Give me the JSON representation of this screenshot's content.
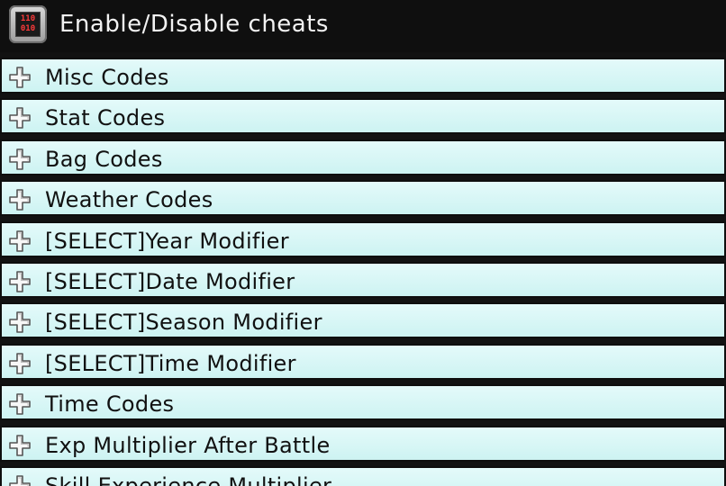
{
  "header": {
    "title": "Enable/Disable cheats",
    "app_icon": {
      "name": "cheat-chip-icon",
      "glyph_text": "110\n010",
      "glyph_color": "#ff3b3b"
    }
  },
  "colors": {
    "row_background": "#d4f5f4",
    "header_background": "#0f0f0f",
    "title_text": "#f2f2f2"
  },
  "list": {
    "items": [
      {
        "label": "Misc Codes"
      },
      {
        "label": "Stat Codes"
      },
      {
        "label": "Bag Codes"
      },
      {
        "label": "Weather Codes"
      },
      {
        "label": "[SELECT]Year Modifier"
      },
      {
        "label": "[SELECT]Date Modifier"
      },
      {
        "label": "[SELECT]Season Modifier"
      },
      {
        "label": "[SELECT]Time Modifier"
      },
      {
        "label": "Time Codes"
      },
      {
        "label": "Exp Multiplier After Battle"
      },
      {
        "label": "Skill Experience Multiplier"
      }
    ]
  }
}
